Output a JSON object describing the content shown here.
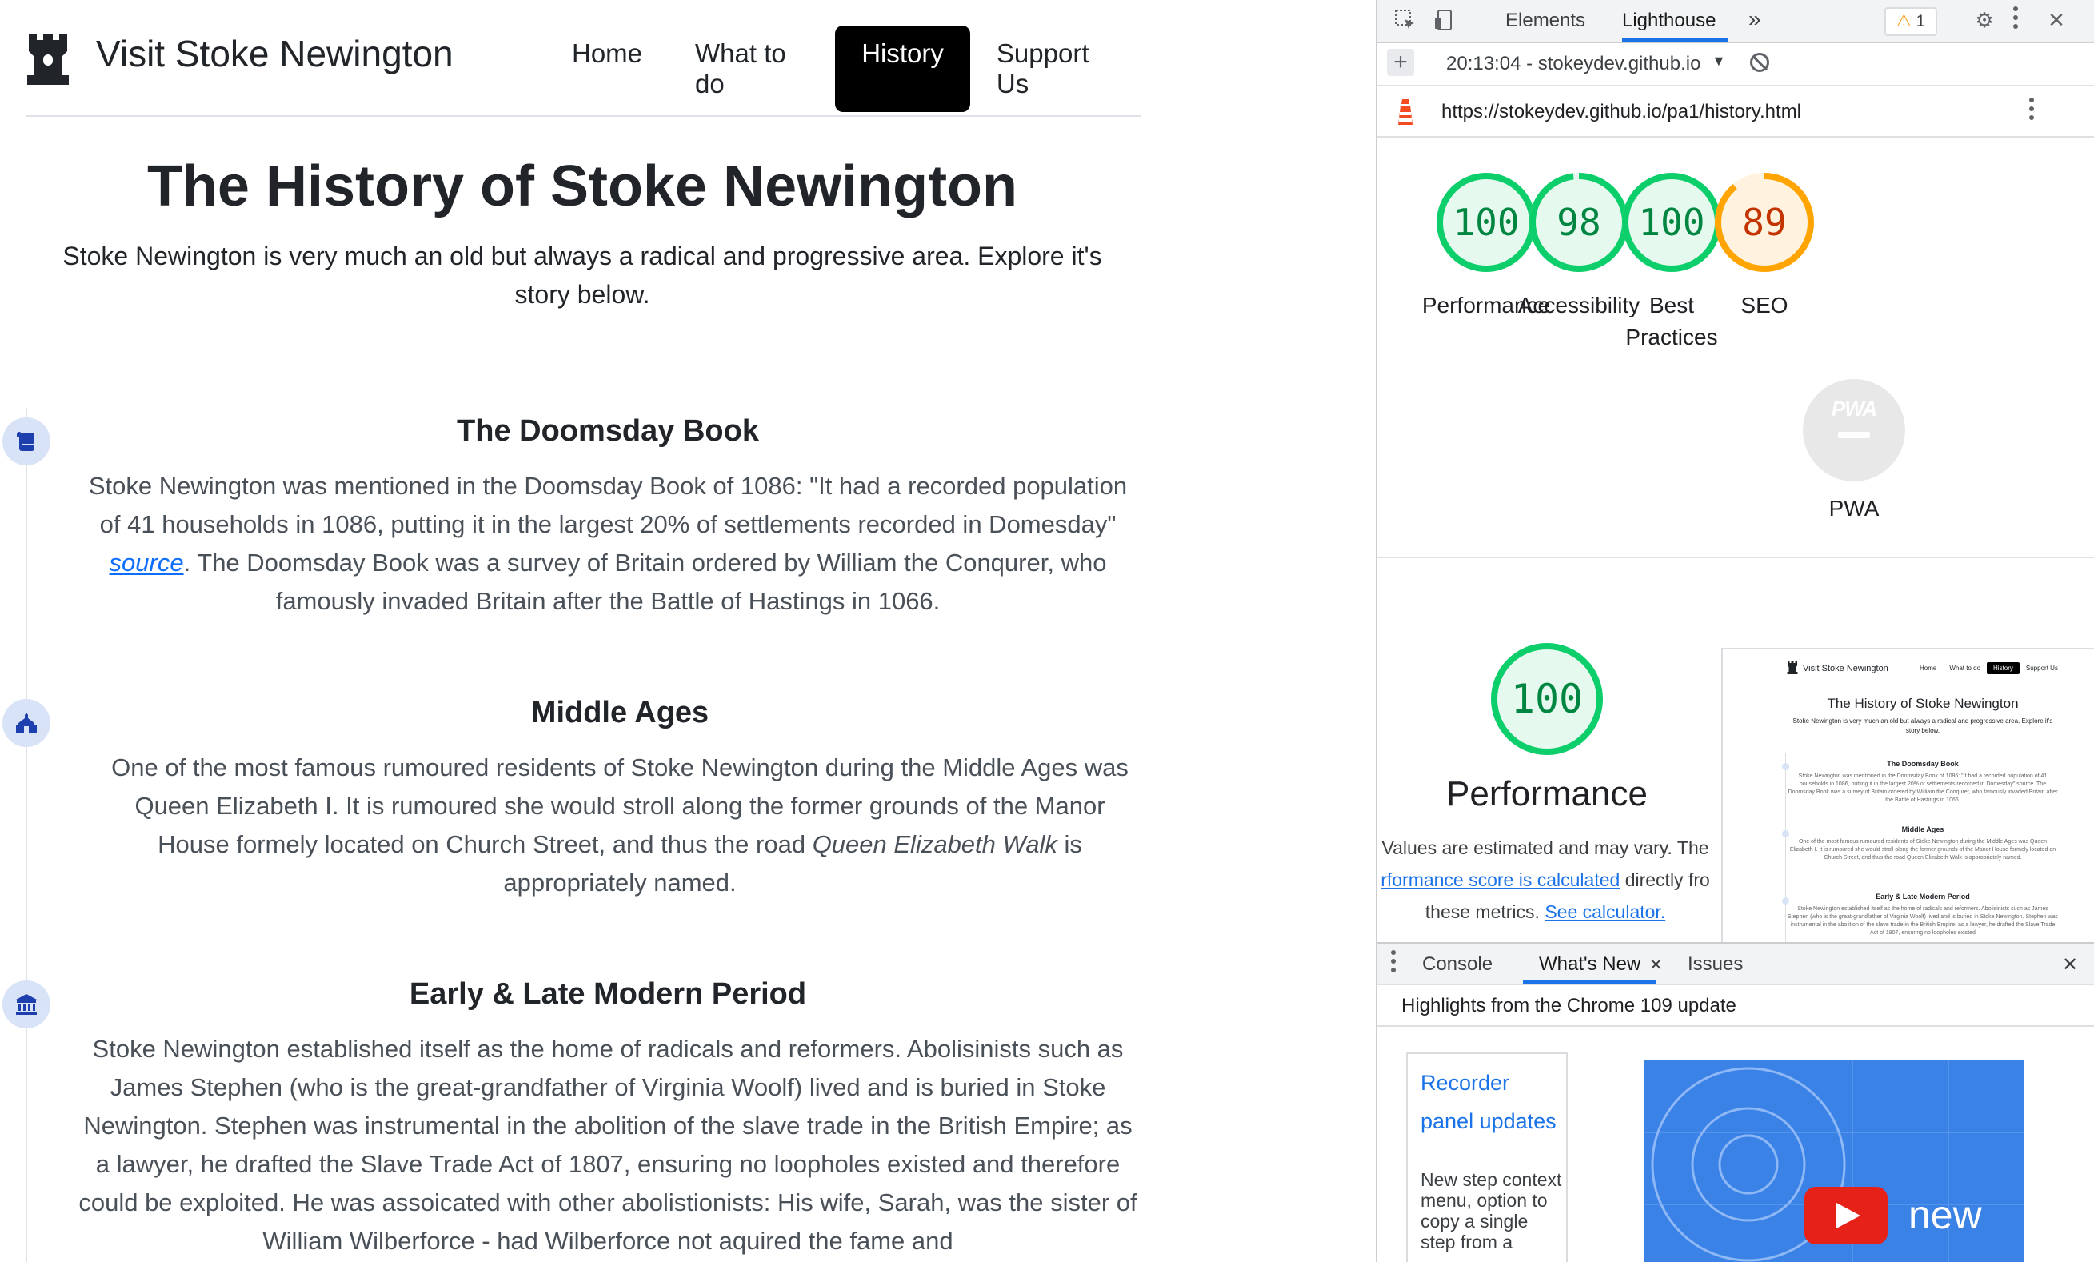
{
  "site": {
    "brand": "Visit Stoke Newington",
    "nav": [
      {
        "label": "Home",
        "active": false
      },
      {
        "label": "What to do",
        "active": false
      },
      {
        "label": "History",
        "active": true
      },
      {
        "label": "Support Us",
        "active": false
      }
    ],
    "title": "The History of Stoke Newington",
    "intro": "Stoke Newington is very much an old but always a radical and progressive area. Explore it's story below.",
    "sections": [
      {
        "heading": "The Doomsday Book",
        "icon": "scroll-icon",
        "text_before": "Stoke Newington was mentioned in the Doomsday Book of 1086: \"It had a recorded population of 41 households in 1086, putting it in the largest 20% of settlements recorded in Domesday\" ",
        "link": "source",
        "text_after": ". The Doomsday Book was a survey of Britain ordered by William the Conqurer, who famously invaded Britain after the Battle of Hastings in 1066."
      },
      {
        "heading": "Middle Ages",
        "icon": "church-icon",
        "text_before": "One of the most famous rumoured residents of Stoke Newington during the Middle Ages was Queen Elizabeth I. It is rumoured she would stroll along the former grounds of the Manor House formely located on Church Street, and thus the road ",
        "emphasis": "Queen Elizabeth Walk",
        "text_after": " is appropriately named."
      },
      {
        "heading": "Early & Late Modern Period",
        "icon": "landmark-icon",
        "text": "Stoke Newington established itself as the home of radicals and reformers. Abolisinists such as James Stephen (who is the great-grandfather of Virginia Woolf) lived and is buried in Stoke Newington. Stephen was instrumental in the abolition of the slave trade in the British Empire; as a lawyer, he drafted the Slave Trade Act of 1807, ensuring no loopholes existed and therefore could be exploited. He was assoicated with other abolistionists: His wife, Sarah, was the sister of William Wilberforce - had Wilberforce not aquired the fame and"
      }
    ]
  },
  "devtools": {
    "tabs": [
      "Elements",
      "Lighthouse"
    ],
    "active_tab": "Lighthouse",
    "more_tabs": "»",
    "warning_count": "1",
    "report_select": "20:13:04 - stokeydev.github.io",
    "url": "https://stokeydev.github.io/pa1/history.html",
    "scores": [
      {
        "label": "Performance",
        "value": 100,
        "color": "#0cce6b",
        "text_color": "#018642"
      },
      {
        "label": "Accessibility",
        "value": 98,
        "color": "#0cce6b",
        "text_color": "#018642"
      },
      {
        "label": "Best Practices",
        "value": 100,
        "color": "#0cce6b",
        "text_color": "#018642"
      },
      {
        "label": "SEO",
        "value": 89,
        "color": "#ffa400",
        "text_color": "#c33300"
      }
    ],
    "pwa": {
      "label": "PWA",
      "badge": "PWA"
    },
    "performance": {
      "score": 100,
      "title": "Performance",
      "desc_line1": "Values are estimated and may vary. The",
      "desc_link1": "rformance score is calculated",
      "desc_mid": " directly fro",
      "desc_line3": "these metrics. ",
      "desc_link2": "See calculator."
    },
    "thumbnail": {
      "brand": "Visit Stoke Newington",
      "nav": [
        "Home",
        "What to do",
        "History",
        "Support Us"
      ],
      "title": "The History of Stoke Newington",
      "intro": "Stoke Newington is very much an old but always a radical and progressive area. Explore it's story below.",
      "h1": "The Doomsday Book",
      "p1": "Stoke Newington was mentioned in the Doomsday Book of 1086: \"It had a recorded population of 41 households in 1086, putting it in the largest 20% of settlements recorded in Domesday\" source. The Doomsday Book was a survey of Britain ordered by William the Conqurer, who famously invaded Britain after the Battle of Hastings in 1066.",
      "h2": "Middle Ages",
      "p2": "One of the most famous rumoured residents of Stoke Newington during the Middle Ages was Queen Elizabeth I. It is rumoured she would stroll along the former grounds of the Manor House formely located on Church Street, and thus the road Queen Elizabeth Walk is appropriately named.",
      "h3": "Early & Late Modern Period",
      "p3": "Stoke Newington established itself as the home of radicals and reformers. Abolisinists such as James Stephen (who is the great-grandfather of Virginia Woolf) lived and is buried in Stoke Newington. Stephen was instrumental in the abolition of the slave trade in the British Empire; as a lawyer, he drafted the Slave Trade Act of 1807, ensuring no loopholes existed"
    },
    "drawer": {
      "tabs": [
        "Console",
        "What's New",
        "Issues"
      ],
      "active_tab": "What's New",
      "highlights": "Highlights from the Chrome 109 update",
      "card_link": "Recorder panel updates",
      "card_desc": "New step context menu, option to copy a single step from a",
      "video_text": "new"
    }
  }
}
